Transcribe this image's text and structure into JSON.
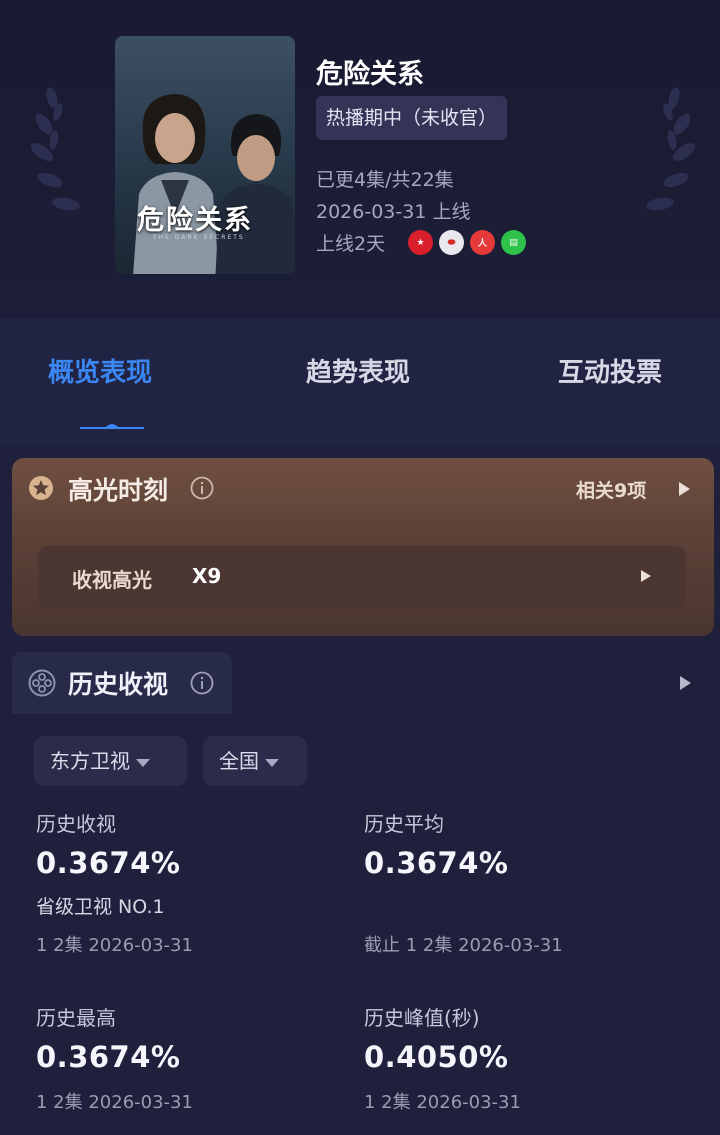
{
  "show": {
    "title": "危险关系",
    "status": "热播期中（未收官）",
    "episodes": "已更4集/共22集",
    "premiere": "2026-03-31 上线",
    "days_online": "上线2天",
    "poster_title": "危险关系",
    "poster_subtitle": "THE DARK SECRETS",
    "platforms": [
      "dragon-tv-icon",
      "migu-icon",
      "mango-icon",
      "iqiyi-icon"
    ]
  },
  "tabs": [
    {
      "label": "概览表现",
      "active": true
    },
    {
      "label": "趋势表现",
      "active": false
    },
    {
      "label": "互动投票",
      "active": false
    }
  ],
  "highlights": {
    "title": "高光时刻",
    "related": "相关9项",
    "row_label": "收视高光",
    "row_count": "X9"
  },
  "history": {
    "title": "历史收视",
    "channel": "东方卫视",
    "region": "全国",
    "stats": [
      {
        "label": "历史收视",
        "value": "0.3674%",
        "note": "省级卫视 NO.1",
        "sub": "1 2集 2026-03-31"
      },
      {
        "label": "历史平均",
        "value": "0.3674%",
        "note": "",
        "sub": "截止 1 2集 2026-03-31"
      },
      {
        "label": "历史最高",
        "value": "0.3674%",
        "note": "",
        "sub": "1 2集 2026-03-31"
      },
      {
        "label": "历史峰值(秒)",
        "value": "0.4050%",
        "note": "",
        "sub": "1 2集 2026-03-31"
      }
    ]
  },
  "colors": {
    "accent": "#3a86f3",
    "background": "#1b1d35",
    "highlight_card": "#5c4137"
  }
}
